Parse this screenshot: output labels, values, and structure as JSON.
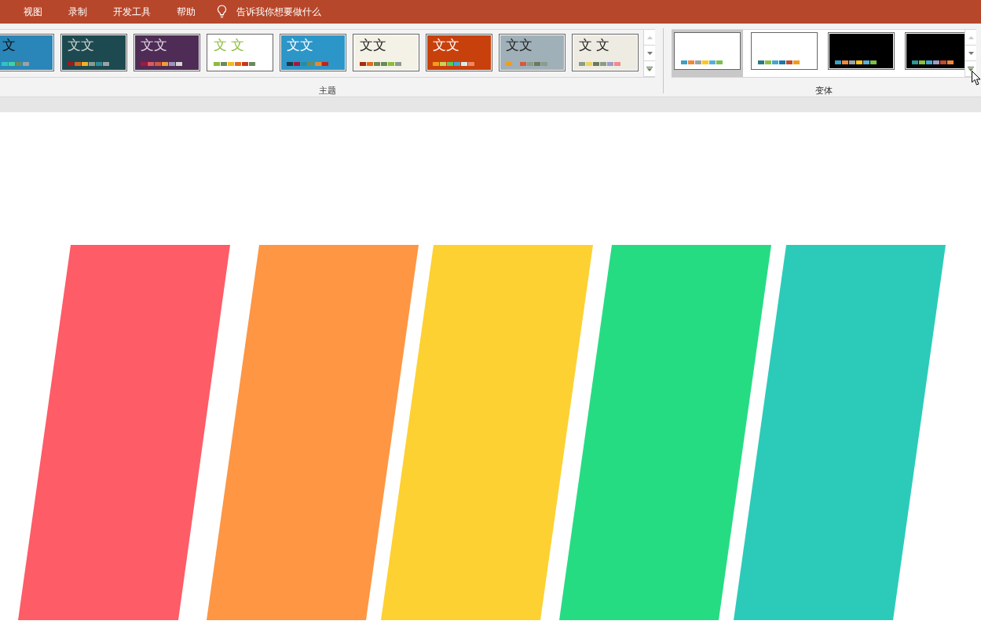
{
  "menu_tabs": [
    {
      "label": "视图",
      "selected": false
    },
    {
      "label": "录制",
      "selected": false
    },
    {
      "label": "开发工具",
      "selected": false
    },
    {
      "label": "帮助",
      "selected": false
    }
  ],
  "tell_me": {
    "placeholder": "告诉我你想要做什么"
  },
  "themes": {
    "label": "主题",
    "items": [
      {
        "sample": "文",
        "selected": false
      },
      {
        "sample": "文文",
        "selected": false
      },
      {
        "sample": "文文",
        "selected": false
      },
      {
        "sample": "文 文",
        "selected": false
      },
      {
        "sample": "文文",
        "selected": false
      },
      {
        "sample": "文文",
        "selected": false
      },
      {
        "sample": "文文",
        "selected": false
      },
      {
        "sample": "文文",
        "selected": false
      },
      {
        "sample": "文 文",
        "selected": false
      }
    ]
  },
  "variants": {
    "label": "变体",
    "items": [
      {
        "selected": true
      },
      {
        "selected": false
      },
      {
        "selected": false
      },
      {
        "selected": false
      }
    ]
  },
  "slide": {
    "stripes": [
      {
        "color": "#fe5c67"
      },
      {
        "color": "#fe9644"
      },
      {
        "color": "#fdd131"
      },
      {
        "color": "#26dc83"
      },
      {
        "color": "#2ccbb9"
      }
    ]
  }
}
